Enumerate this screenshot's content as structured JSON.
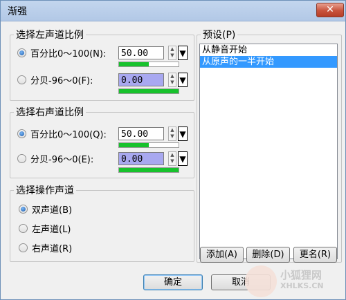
{
  "window": {
    "title": "渐强",
    "close_symbol": "✕"
  },
  "left_channel": {
    "legend": "选择左声道比例",
    "percent_label": "百分比0～100(N):",
    "percent_value": "50.00",
    "percent_level": 0.5,
    "db_label": "分贝-96～0(F):",
    "db_value": "0.00",
    "db_level": 1.0
  },
  "right_channel": {
    "legend": "选择右声道比例",
    "percent_label": "百分比0～100(Q):",
    "percent_value": "50.00",
    "percent_level": 0.5,
    "db_label": "分贝-96～0(E):",
    "db_value": "0.00",
    "db_level": 1.0
  },
  "channel_select": {
    "legend": "选择操作声道",
    "options": [
      "双声道(B)",
      "左声道(L)",
      "右声道(R)"
    ],
    "selected": "双声道(B)"
  },
  "presets": {
    "legend": "预设(P)",
    "items": [
      "从静音开始",
      "从原声的一半开始"
    ],
    "selected": "从原声的一半开始",
    "add_label": "添加(A)",
    "delete_label": "删除(D)",
    "rename_label": "更名(R)"
  },
  "buttons": {
    "ok_label": "确定",
    "cancel_label": "取消"
  },
  "watermark": {
    "brand": "小狐狸网",
    "domain": "XHLKS.CN"
  },
  "icons": {
    "spin": "spin-up-down-icon",
    "arrow": "down-triangle-icon",
    "close": "close-icon"
  },
  "colors": {
    "level_fill": "#17c22c",
    "db_field": "#a8a8f0",
    "selection": "#3399ff",
    "close_button": "#c8533c"
  }
}
